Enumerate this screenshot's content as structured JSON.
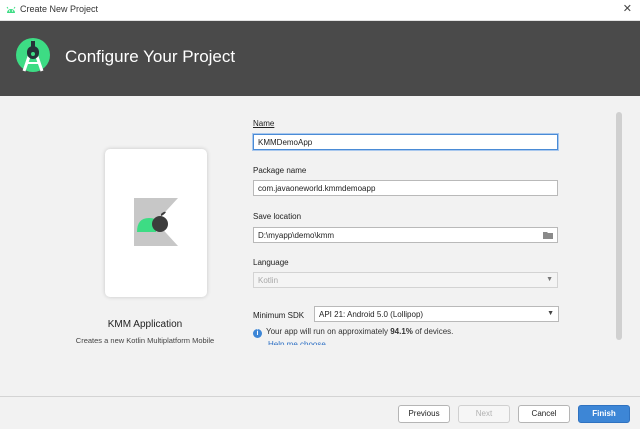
{
  "window": {
    "title": "Create New Project",
    "close_glyph": "✕",
    "icon": "android-icon"
  },
  "header": {
    "title": "Configure Your Project",
    "logo": "android-studio-logo"
  },
  "template": {
    "name": "KMM Application",
    "description": "Creates a new Kotlin Multiplatform Mobile",
    "icon": "kmm-icon"
  },
  "form": {
    "name": {
      "label": "Name",
      "value": "KMMDemoApp"
    },
    "package": {
      "label": "Package name",
      "value": "com.javaoneworld.kmmdemoapp"
    },
    "save_location": {
      "label": "Save location",
      "value": "D:\\myapp\\demo\\kmm",
      "icon": "folder-icon"
    },
    "language": {
      "label": "Language",
      "value": "Kotlin"
    },
    "min_sdk": {
      "label": "Minimum SDK",
      "value": "API 21: Android 5.0 (Lollipop)"
    },
    "info": {
      "prefix": "Your app will run on approximately ",
      "percent": "94.1%",
      "suffix": " of devices."
    },
    "help_link": "Help me choose"
  },
  "footer": {
    "previous": "Previous",
    "next": "Next",
    "cancel": "Cancel",
    "finish": "Finish"
  },
  "colors": {
    "header_bg": "#4a4a4a",
    "accent": "#3d86d6",
    "android_green": "#3ddc84"
  }
}
